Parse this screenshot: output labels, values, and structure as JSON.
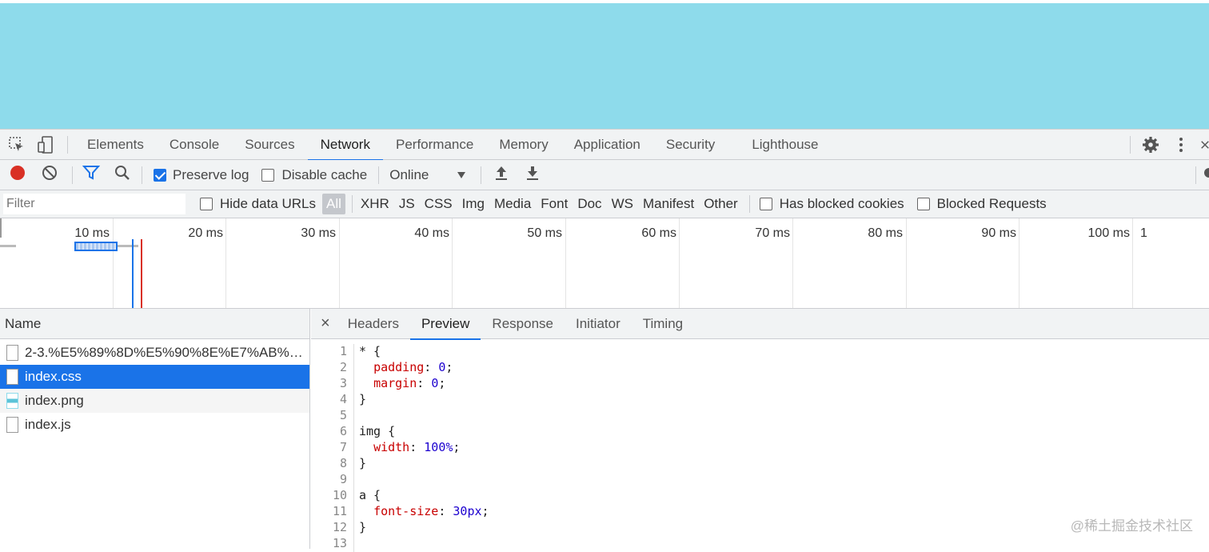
{
  "devtools": {
    "tabs": [
      "Elements",
      "Console",
      "Sources",
      "Network",
      "Performance",
      "Memory",
      "Application",
      "Security",
      "Lighthouse"
    ],
    "active_tab": "Network"
  },
  "toolbar": {
    "preserve_log": "Preserve log",
    "disable_cache": "Disable cache",
    "throttle": "Online"
  },
  "filter": {
    "placeholder": "Filter",
    "hide_data_urls": "Hide data URLs",
    "types": [
      "All",
      "XHR",
      "JS",
      "CSS",
      "Img",
      "Media",
      "Font",
      "Doc",
      "WS",
      "Manifest",
      "Other"
    ],
    "has_blocked_cookies": "Has blocked cookies",
    "blocked_requests": "Blocked Requests"
  },
  "timeline": {
    "ticks": [
      "10 ms",
      "20 ms",
      "30 ms",
      "40 ms",
      "50 ms",
      "60 ms",
      "70 ms",
      "80 ms",
      "90 ms",
      "100 ms",
      "1"
    ]
  },
  "requests": {
    "header": "Name",
    "items": [
      {
        "name": "2-3.%E5%89%8D%E5%90%8E%E7%AB%AF%...",
        "icon": "document-icon"
      },
      {
        "name": "index.css",
        "icon": "document-icon",
        "selected": true
      },
      {
        "name": "index.png",
        "icon": "image-icon"
      },
      {
        "name": "index.js",
        "icon": "document-icon"
      }
    ]
  },
  "detail": {
    "close": "×",
    "tabs": [
      "Headers",
      "Preview",
      "Response",
      "Initiator",
      "Timing"
    ],
    "active_tab": "Preview",
    "code_lines": [
      "* {",
      "  padding: 0;",
      "  margin: 0;",
      "}",
      "",
      "img {",
      "  width: 100%;",
      "}",
      "",
      "a {",
      "  font-size: 30px;",
      "}",
      ""
    ]
  },
  "watermark": "@稀土掘金技术社区",
  "colors": {
    "page_bg": "#8edbeb",
    "accent": "#1a73e8",
    "record": "#d93025"
  }
}
